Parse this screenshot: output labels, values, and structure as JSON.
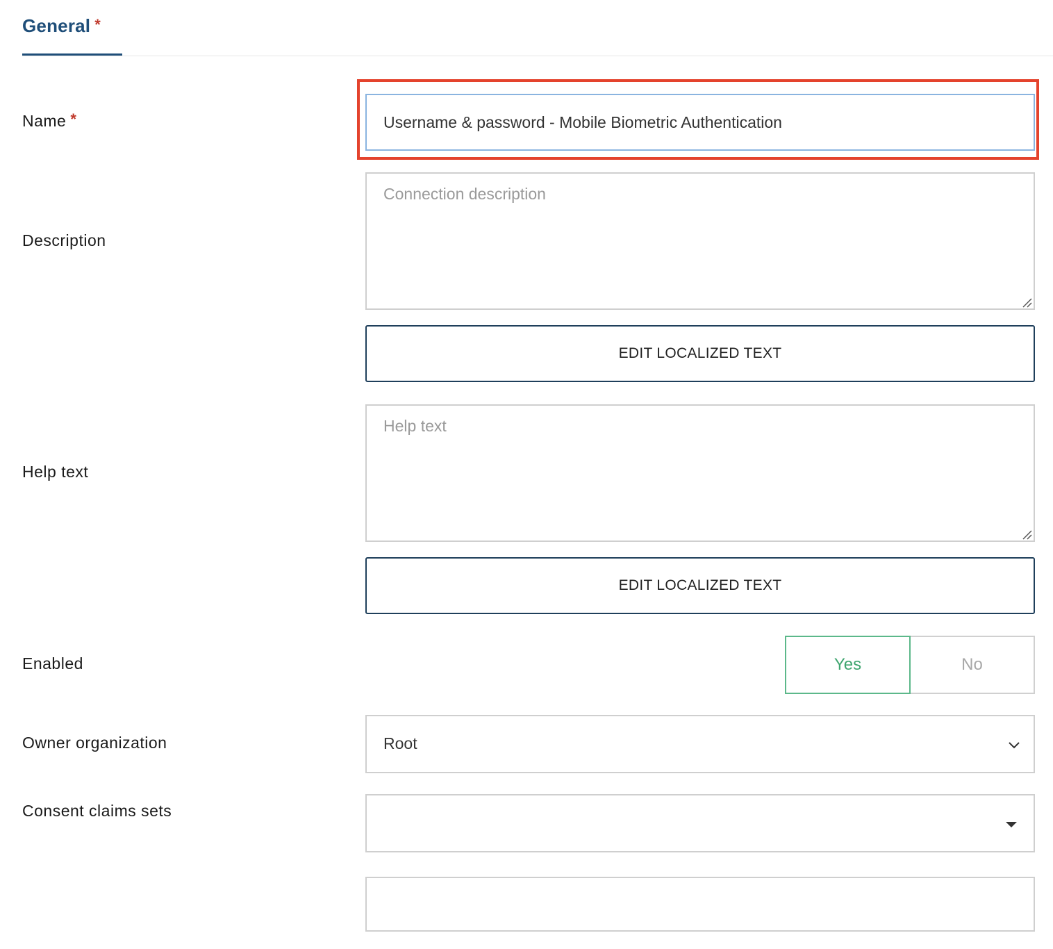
{
  "tabs": {
    "general_label": "General",
    "required_mark": "*"
  },
  "form": {
    "name": {
      "label": "Name",
      "required_mark": "*",
      "value": "Username & password - Mobile Biometric Authentication"
    },
    "description": {
      "label": "Description",
      "placeholder": "Connection description",
      "button_label": "EDIT LOCALIZED TEXT"
    },
    "help_text": {
      "label": "Help text",
      "placeholder": "Help text",
      "button_label": "EDIT LOCALIZED TEXT"
    },
    "enabled": {
      "label": "Enabled",
      "yes_label": "Yes",
      "no_label": "No",
      "selected": "Yes"
    },
    "owner_organization": {
      "label": "Owner organization",
      "value": "Root"
    },
    "consent_claims_sets": {
      "label": "Consent claims sets",
      "value": ""
    }
  },
  "colors": {
    "tab_accent": "#1f4e79",
    "required": "#c0392b",
    "highlight": "#e4432d",
    "yes_green": "#3fa56f"
  },
  "icons": {
    "owner_select": "chevron-down-icon",
    "consent_select": "caret-down-icon",
    "textarea_grip": "resize-grip-icon"
  }
}
